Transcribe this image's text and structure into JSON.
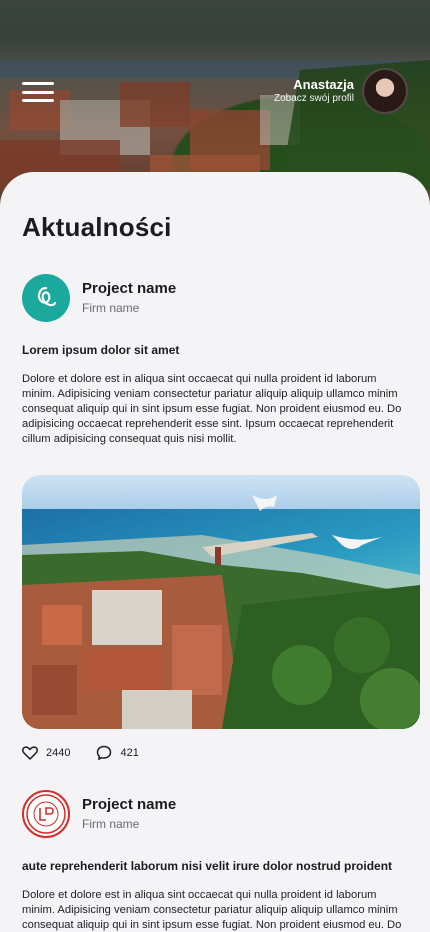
{
  "header": {
    "user_name": "Anastazja",
    "profile_link": "Zobacz swój profil"
  },
  "page": {
    "title": "Aktualności"
  },
  "posts": [
    {
      "project_name": "Project name",
      "firm_name": "Firm name",
      "title": "Lorem ipsum dolor sit amet",
      "body": "Dolore et dolore est in aliqua sint occaecat qui nulla proident id laborum minim. Adipisicing veniam consectetur pariatur aliquip aliquip ullamco minim consequat aliquip qui in sint ipsum esse fugiat. Non proident eiusmod eu. Do adipisicing occaecat reprehenderit esse sint. Ipsum occaecat reprehenderit cillum adipisicing consequat quis nisi mollit.",
      "likes": "2440",
      "comments": "421"
    },
    {
      "project_name": "Project name",
      "firm_name": "Firm name",
      "title": "aute reprehenderit laborum nisi velit irure dolor nostrud proident",
      "body": "Dolore et dolore est in aliqua sint occaecat qui nulla proident id laborum minim. Adipisicing veniam consectetur pariatur aliquip aliquip ullamco minim consequat aliquip qui in sint ipsum esse fugiat. Non proident eiusmod eu. Do adipisicing occaecat reprehenderit esse sint. Ipsum occaecat reprehenderit cillum adipisicing consequat quis nisi mollit."
    }
  ],
  "icons": {
    "menu": "hamburger-menu-icon",
    "like": "heart-icon",
    "comment": "comment-icon"
  },
  "colors": {
    "teal_logo": "#1aa99c",
    "red_logo": "#d92b2b",
    "background": "#f4f4f6"
  }
}
